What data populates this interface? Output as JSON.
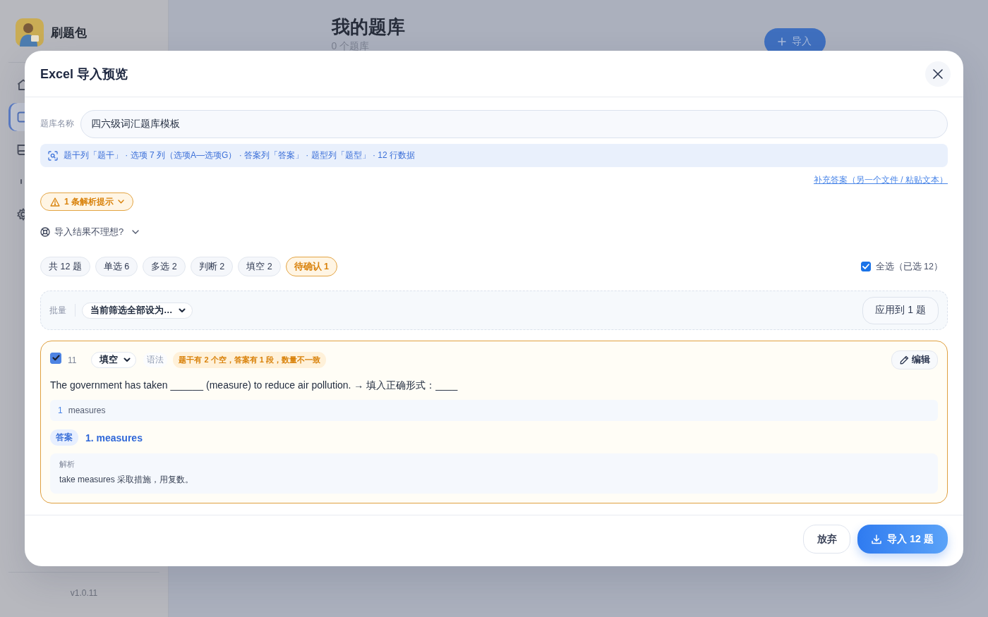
{
  "sidebar": {
    "app_name": "刷题包",
    "nav": [
      {
        "selected": false
      },
      {
        "selected": true
      },
      {
        "selected": false
      },
      {
        "selected": false
      },
      {
        "selected": false
      }
    ],
    "version": "v1.0.11"
  },
  "page": {
    "title": "我的题库",
    "subtitle": "0 个题库",
    "import_button": "导入"
  },
  "dialog": {
    "title": "Excel 导入预览",
    "name_field": {
      "label": "题库名称",
      "value": "四六级词汇题库模板"
    },
    "detected_columns": "题干列「题干」 · 选项 7 列（选项A—选项G） · 答案列「答案」 · 题型列「题型」 · 12 行数据",
    "supplement_link": "补充答案（另一个文件 / 粘贴文本）",
    "warnings_toggle": {
      "label": "1 条解析提示",
      "expanded": false
    },
    "help_toggle": {
      "label": "导入结果不理想?",
      "expanded": false
    },
    "filters": [
      {
        "label": "共 12 题",
        "selected": false
      },
      {
        "label": "单选 6",
        "selected": false
      },
      {
        "label": "多选 2",
        "selected": false
      },
      {
        "label": "判断 2",
        "selected": false
      },
      {
        "label": "填空 2",
        "selected": false
      },
      {
        "label": "待确认 1",
        "selected": true
      }
    ],
    "select_all": {
      "label": "全选（已选 12）",
      "checked": true
    },
    "batch": {
      "label": "批量",
      "select": "当前筛选全部设为…",
      "apply_button": "应用到 1 题"
    },
    "questions": [
      {
        "checked": true,
        "number": "11",
        "type": "填空",
        "tag": "语法",
        "warning": "题干有 2 个空，答案有 1 段，数量不一致",
        "edit_button": "编辑",
        "stem": "The government has taken ______ (measure) to reduce air pollution. → 填入正确形式：____",
        "blanks": [
          {
            "index": "1",
            "text": "measures"
          }
        ],
        "answer_label": "答案",
        "answer": "1. measures",
        "explanation_label": "解析",
        "explanation": "take measures 采取措施，用复数。"
      }
    ],
    "buttons": {
      "discard": "放弃",
      "import": "导入 12 题"
    }
  }
}
